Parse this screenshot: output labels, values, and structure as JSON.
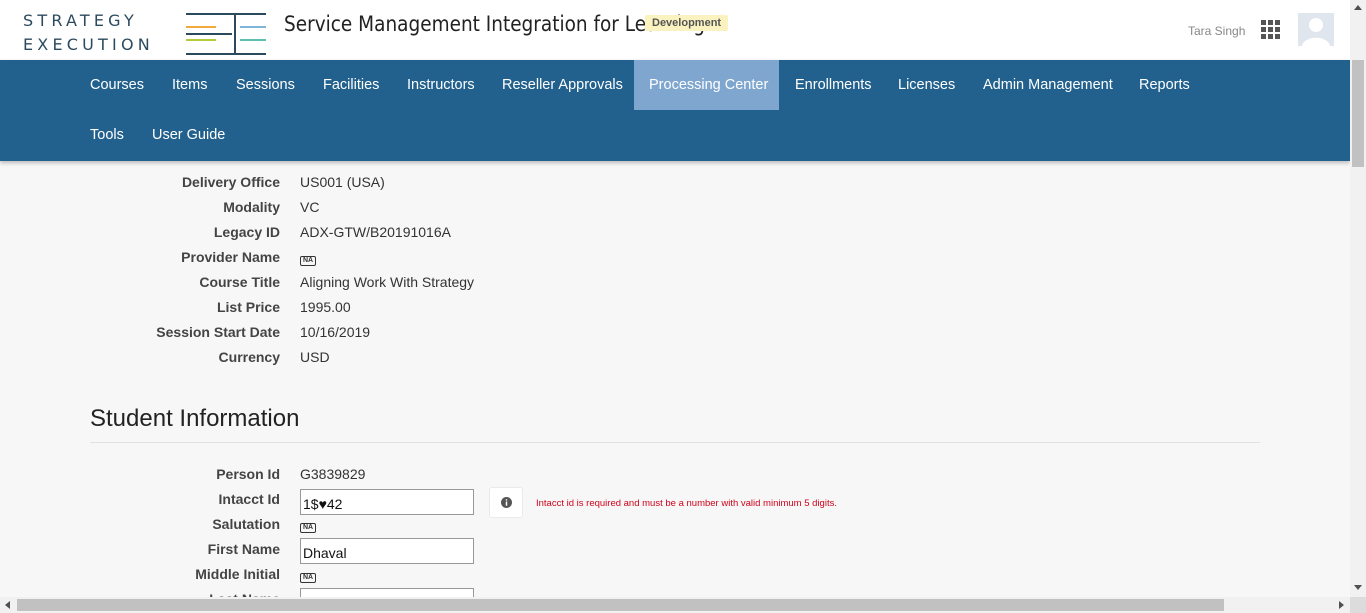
{
  "header": {
    "logo_line1": "STRATEGY",
    "logo_line2": "EXECUTION",
    "app_title": "Service Management Integration for Learning",
    "env_badge": "Development",
    "user_name": "Tara Singh",
    "icons": [
      "apps-grid-icon",
      "user-avatar-icon"
    ]
  },
  "nav": {
    "items": [
      {
        "label": "Courses"
      },
      {
        "label": "Items"
      },
      {
        "label": "Sessions"
      },
      {
        "label": "Facilities"
      },
      {
        "label": "Instructors"
      },
      {
        "label": "Reseller Approvals"
      },
      {
        "label": "Processing Center"
      },
      {
        "label": "Enrollments"
      },
      {
        "label": "Licenses"
      },
      {
        "label": "Admin Management"
      },
      {
        "label": "Reports"
      },
      {
        "label": "Tools"
      },
      {
        "label": "User Guide"
      }
    ],
    "active": "Processing Center"
  },
  "session": {
    "fields": [
      {
        "label": "Delivery Office",
        "value": "US001 (USA)"
      },
      {
        "label": "Modality",
        "value": "VC"
      },
      {
        "label": "Legacy ID",
        "value": "ADX-GTW/B20191016A"
      },
      {
        "label": "Provider Name",
        "value": "NA"
      },
      {
        "label": "Course Title",
        "value": "Aligning Work With Strategy"
      },
      {
        "label": "List Price",
        "value": "1995.00"
      },
      {
        "label": "Session Start Date",
        "value": "10/16/2019"
      },
      {
        "label": "Currency",
        "value": "USD"
      }
    ]
  },
  "student": {
    "section_title": "Student Information",
    "person_id_label": "Person Id",
    "person_id_value": "G3839829",
    "intacct_id_label": "Intacct Id",
    "intacct_id_value": "1$♥42",
    "intacct_error": "Intacct id is required and must be a number with valid minimum 5 digits.",
    "salutation_label": "Salutation",
    "salutation_value": "NA",
    "first_name_label": "First Name",
    "first_name_value": "Dhaval",
    "middle_initial_label": "Middle Initial",
    "middle_initial_value": "NA",
    "last_name_label": "Last Name"
  },
  "colors": {
    "nav_bg": "#22618d",
    "nav_active": "#7fa6cf",
    "error": "#d0021b",
    "badge_bg": "#faf3c0"
  }
}
